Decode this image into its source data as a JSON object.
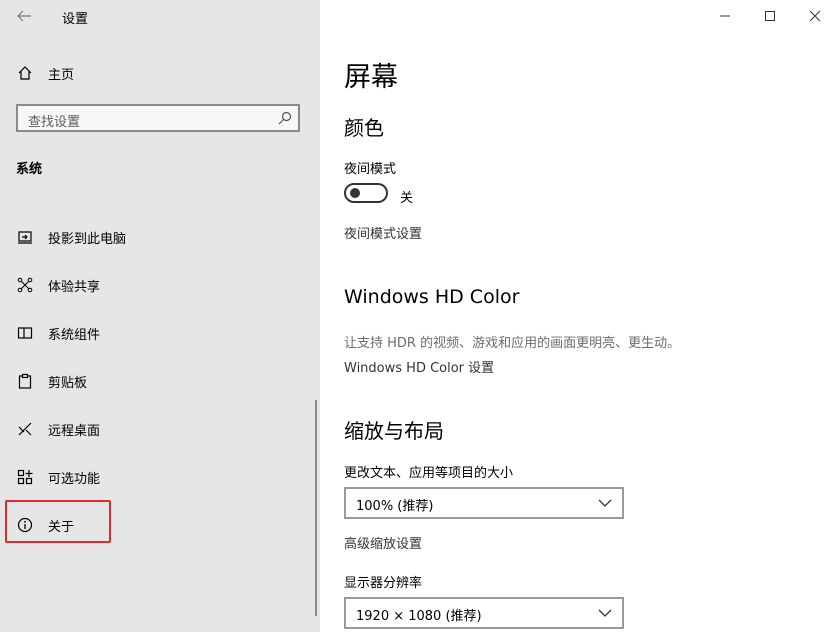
{
  "window": {
    "title": "设置"
  },
  "sidebar": {
    "home_label": "主页",
    "search_placeholder": "查找设置",
    "section_title": "系统",
    "items": [
      {
        "label": "投影到此电脑",
        "icon": "project-icon"
      },
      {
        "label": "体验共享",
        "icon": "share-icon"
      },
      {
        "label": "系统组件",
        "icon": "components-icon"
      },
      {
        "label": "剪贴板",
        "icon": "clipboard-icon"
      },
      {
        "label": "远程桌面",
        "icon": "remote-desktop-icon"
      },
      {
        "label": "可选功能",
        "icon": "optional-features-icon"
      },
      {
        "label": "关于",
        "icon": "info-icon"
      }
    ],
    "highlight_color": "#e0282f"
  },
  "main": {
    "title": "屏幕",
    "color_section": {
      "title": "颜色",
      "night_mode_label": "夜间模式",
      "night_mode_state": "关",
      "night_mode_on": false,
      "night_mode_settings_link": "夜间模式设置"
    },
    "hd_color_section": {
      "title": "Windows HD Color",
      "description": "让支持 HDR 的视频、游戏和应用的画面更明亮、更生动。",
      "settings_link": "Windows HD Color 设置"
    },
    "scale_section": {
      "title": "缩放与布局",
      "text_size_label": "更改文本、应用等项目的大小",
      "scale_value": "100% (推荐)",
      "advanced_scaling_link": "高级缩放设置",
      "resolution_label": "显示器分辨率",
      "resolution_value": "1920 × 1080 (推荐)"
    }
  }
}
